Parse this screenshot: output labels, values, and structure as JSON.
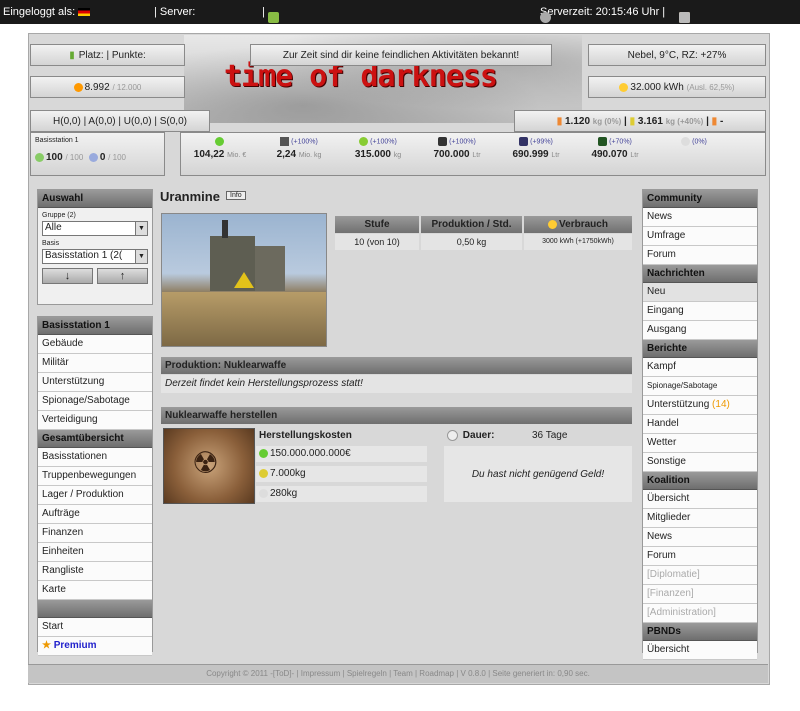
{
  "topbar": {
    "login_label": "Eingeloggt als:",
    "server_label": "| Server:",
    "sep": "|",
    "server_time": "Serverzeit: 20:15:46 Uhr |"
  },
  "header": {
    "platz": "Platz:",
    "punkte": "| Punkte:",
    "notice": "Zur Zeit sind dir keine feindlichen Aktivitäten bekannt!",
    "weather": "Nebel, 9°C, RZ: +27%",
    "points_value": "8.992",
    "points_total": "/ 12.000",
    "energy_value": "32.000 kWh",
    "energy_sub": "(Ausl. 62,5%)",
    "hauq": "H(0,0) | A(0,0) | U(0,0) | S(0,0)",
    "pop1_value": "1.120",
    "pop1_sub": "kg (0%)",
    "pop2_value": "3.161",
    "pop2_sub": "kg (+40%)",
    "pop3_sub": "-",
    "logo_text": "time of darkness"
  },
  "base": {
    "name": "Basisstation 1",
    "val1": "100",
    "val1_max": "/ 100",
    "val2": "0",
    "val2_max": "/ 100"
  },
  "resources": [
    {
      "pct": "",
      "value": "104,22",
      "unit": "Mio. €",
      "color": "#6c3"
    },
    {
      "pct": "(+100%)",
      "value": "2,24",
      "unit": "Mio. kg",
      "color": "#555"
    },
    {
      "pct": "(+100%)",
      "value": "315.000",
      "unit": "kg",
      "color": "#8c3"
    },
    {
      "pct": "(+100%)",
      "value": "700.000",
      "unit": "Ltr",
      "color": "#333"
    },
    {
      "pct": "(+99%)",
      "value": "690.999",
      "unit": "Ltr",
      "color": "#336"
    },
    {
      "pct": "(+70%)",
      "value": "490.070",
      "unit": "Ltr",
      "color": "#252"
    },
    {
      "pct": "(0%)",
      "value": "",
      "unit": "",
      "color": "#ddd"
    }
  ],
  "left": {
    "auswahl": "Auswahl",
    "gruppe_label": "Gruppe (2)",
    "gruppe_value": "Alle",
    "basis_label": "Basis",
    "basis_value": "Basisstation 1 (2(",
    "down": "↓",
    "up": "↑",
    "base_title": "Basisstation 1",
    "base_items": [
      "Gebäude",
      "Militär",
      "Unterstützung",
      "Spionage/Sabotage",
      "Verteidigung"
    ],
    "overview_title": "Gesamtübersicht",
    "overview_items": [
      "Basisstationen",
      "Truppenbewegungen",
      "Lager / Produktion",
      "Aufträge",
      "Finanzen",
      "Einheiten",
      "Rangliste",
      "Karte"
    ],
    "start": "Start",
    "premium": "Premium"
  },
  "main": {
    "title": "Uranmine",
    "info": "Info",
    "table_headers": [
      "Stufe",
      "Produktion / Std.",
      "Verbrauch"
    ],
    "table_row": [
      "10 (von 10)",
      "0,50 kg",
      "3000 kWh (+1750kWh)"
    ],
    "prod_header": "Produktion: Nuklearwaffe",
    "prod_text": "Derzeit findet kein Herstellungsprozess statt!",
    "build_header": "Nuklearwaffe herstellen",
    "cost_title": "Herstellungskosten",
    "costs": [
      "150.000.000.000€",
      "7.000kg",
      "280kg"
    ],
    "duration_label": "Dauer:",
    "duration_value": "36 Tage",
    "money_msg": "Du hast nicht genügend Geld!"
  },
  "right": {
    "community": "Community",
    "community_items": [
      "News",
      "Umfrage",
      "Forum"
    ],
    "messages": "Nachrichten",
    "messages_items": [
      "Neu",
      "Eingang",
      "Ausgang"
    ],
    "reports": "Berichte",
    "reports_items": [
      "Kampf",
      "Spionage/Sabotage",
      "Unterstützung",
      "Handel",
      "Wetter",
      "Sonstige"
    ],
    "support_count": "(14)",
    "coalition": "Koalition",
    "coalition_items": [
      "Übersicht",
      "Mitglieder",
      "News",
      "Forum"
    ],
    "coalition_disabled": [
      "[Diplomatie]",
      "[Finanzen]",
      "[Administration]"
    ],
    "pbnds": "PBNDs",
    "pbnds_items": [
      "Übersicht"
    ]
  },
  "footer": "Copyright © 2011 -[ToD]- | Impressum | Spielregeln | Team | Roadmap | V 0.8.0 | Seite generiert in: 0,90 sec."
}
